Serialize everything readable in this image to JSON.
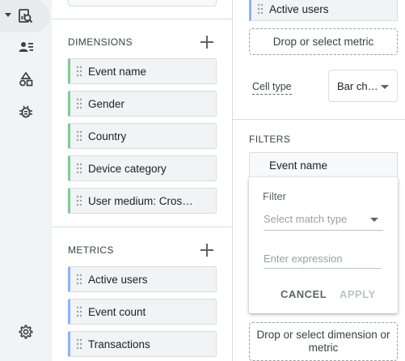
{
  "rail": {
    "items": [
      {
        "icon": "report-explore-icon",
        "active": true
      },
      {
        "icon": "user-list-icon"
      },
      {
        "icon": "shapes-icon"
      },
      {
        "icon": "debug-bug-icon"
      },
      {
        "icon": "settings-gear-icon"
      }
    ]
  },
  "variables": {
    "dimensions_title": "DIMENSIONS",
    "dimensions": [
      "Event name",
      "Gender",
      "Country",
      "Device category",
      "User medium: Cros…"
    ],
    "metrics_title": "METRICS",
    "metrics": [
      "Active users",
      "Event count",
      "Transactions"
    ]
  },
  "tab_settings": {
    "values_chip": "Active users",
    "drop_metric": "Drop or select metric",
    "cell_type_label": "Cell type",
    "cell_type_value": "Bar ch…",
    "filters_title": "FILTERS",
    "filter_dimension": "Event name",
    "filter_card": {
      "title": "Filter",
      "match_type_placeholder": "Select match type",
      "expression_placeholder": "Enter expression",
      "cancel": "CANCEL",
      "apply": "APPLY"
    },
    "drop_dimension_or_metric": "Drop or select dimension or metric"
  },
  "colors": {
    "dimension_accent": "#81c995",
    "metric_accent": "#8ab4f8",
    "rail_bg": "#f1f3f4"
  }
}
